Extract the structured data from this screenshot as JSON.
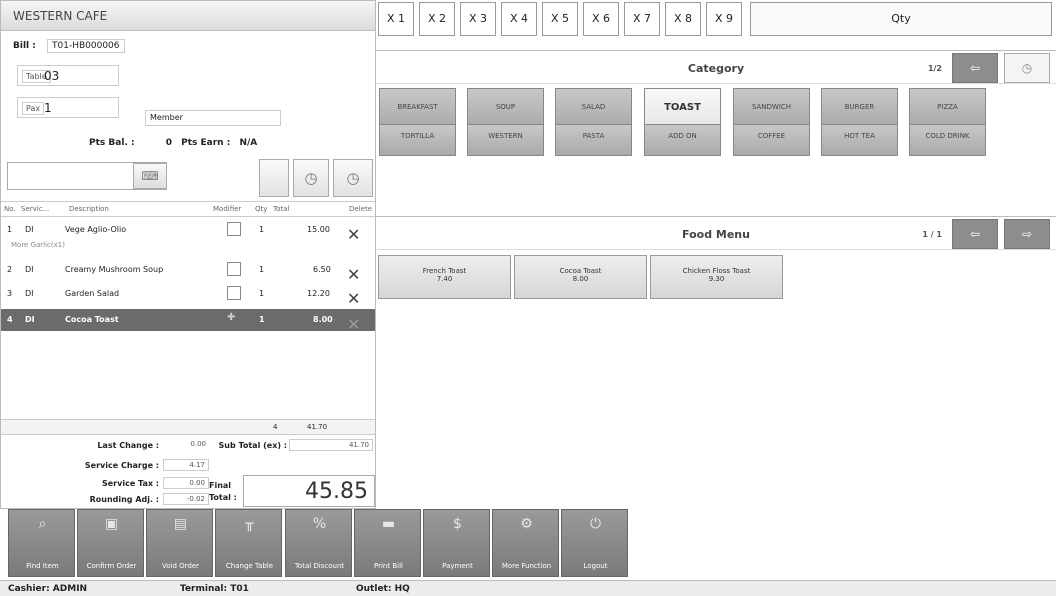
{
  "app": {
    "title": "WESTERN CAFE"
  },
  "bill": {
    "label": "Bill :",
    "number": "T01-HB000006"
  },
  "table": {
    "label": "Table",
    "value": "03"
  },
  "pax": {
    "label": "Pax",
    "value": "1"
  },
  "member": {
    "placeholder": "Member"
  },
  "points": {
    "bal_label": "Pts Bal. :",
    "bal_value": "0",
    "earn_label": "Pts Earn :",
    "earn_value": "N/A"
  },
  "order_grid": {
    "headers": {
      "no": "No.",
      "service": "Servic...",
      "description": "Description",
      "modifier": "Modifier",
      "qty": "Qty",
      "total": "Total",
      "delete": "Delete"
    },
    "rows": [
      {
        "no": "1",
        "service": "DI",
        "description": "Vege Aglio-Olio",
        "qty": "1",
        "total": "15.00",
        "modifier_note": "More Garlic(x1)"
      },
      {
        "no": "2",
        "service": "DI",
        "description": "Creamy Mushroom Soup",
        "qty": "1",
        "total": "6.50"
      },
      {
        "no": "3",
        "service": "DI",
        "description": "Garden Salad",
        "qty": "1",
        "total": "12.20"
      },
      {
        "no": "4",
        "service": "DI",
        "description": "Cocoa Toast",
        "qty": "1",
        "total": "8.00",
        "selected": true
      }
    ],
    "total_qty": "4",
    "total_amount": "41.70"
  },
  "summary": {
    "last_change_label": "Last Change :",
    "last_change": "0.00",
    "subtotal_label": "Sub Total (ex) :",
    "subtotal": "41.70",
    "service_charge_label": "Service Charge :",
    "service_charge": "4.17",
    "service_tax_label": "Service Tax :",
    "service_tax": "0.00",
    "rounding_label": "Rounding Adj. :",
    "rounding": "-0.02",
    "final_label_1": "Final",
    "final_label_2": "Total :",
    "final_total": "45.85"
  },
  "qty_bar": {
    "multipliers": [
      "X 1",
      "X 2",
      "X 3",
      "X 4",
      "X 5",
      "X 6",
      "X 7",
      "X 8",
      "X 9"
    ],
    "qty_label": "Qty"
  },
  "category": {
    "title": "Category",
    "page": "1/2",
    "row1": [
      "BREAKFAST",
      "SOUP",
      "SALAD",
      "TOAST",
      "SANDWICH",
      "BURGER",
      "PIZZA"
    ],
    "row2": [
      "TORTILLA",
      "WESTERN",
      "PASTA",
      "ADD ON",
      "COFFEE",
      "HOT TEA",
      "COLD DRINK"
    ],
    "active": "TOAST"
  },
  "food_menu": {
    "title": "Food Menu",
    "page": "1 / 1",
    "items": [
      {
        "name": "French Toast",
        "price": "7.40"
      },
      {
        "name": "Cocoa Toast",
        "price": "8.00"
      },
      {
        "name": "Chicken Floss Toast",
        "price": "9.30"
      }
    ]
  },
  "functions": [
    {
      "label": "Find Item",
      "icon": "search-icon"
    },
    {
      "label": "Confirm Order",
      "icon": "save-icon"
    },
    {
      "label": "Void Order",
      "icon": "document-icon"
    },
    {
      "label": "Change Table",
      "icon": "table-icon"
    },
    {
      "label": "Total Discount",
      "icon": "percent-icon"
    },
    {
      "label": "Print Bill",
      "icon": "printer-icon"
    },
    {
      "label": "Payment",
      "icon": "cash-icon"
    },
    {
      "label": "More Function",
      "icon": "gear-icon"
    },
    {
      "label": "Logout",
      "icon": "power-icon"
    }
  ],
  "status": {
    "cashier": "Cashier: ADMIN",
    "terminal": "Terminal: T01",
    "outlet": "Outlet: HQ"
  }
}
